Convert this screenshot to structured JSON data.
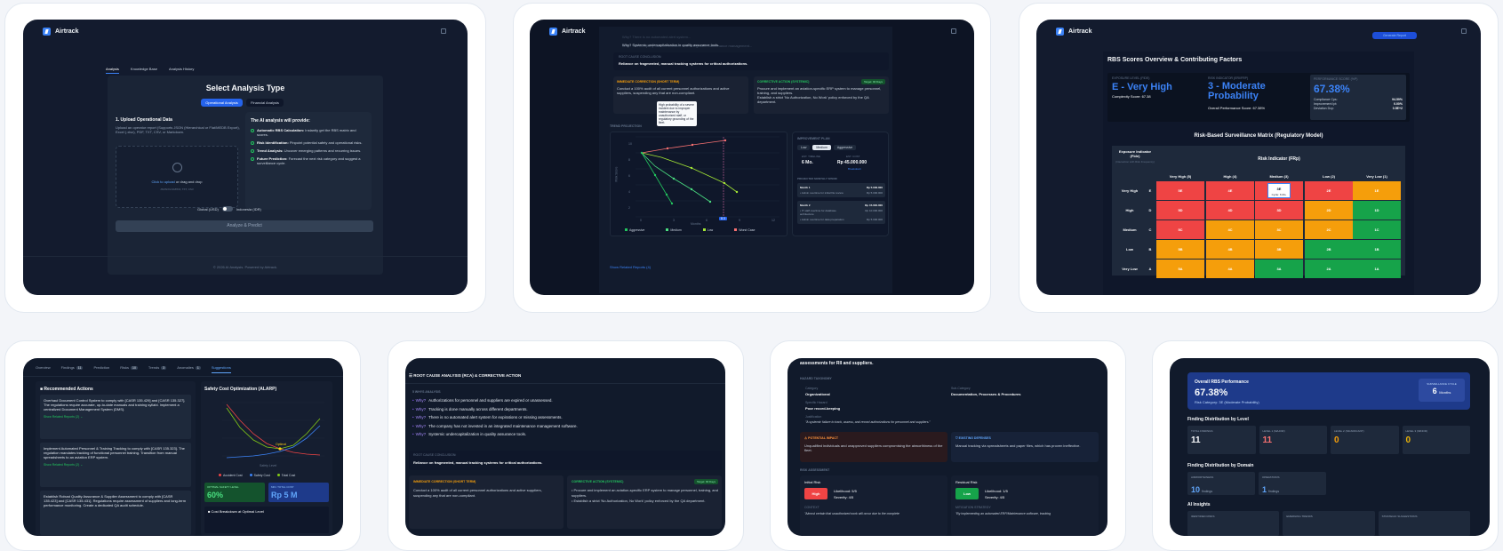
{
  "app": {
    "name": "Airtrack"
  },
  "s1": {
    "tabs": [
      "Analysis",
      "Knowledge Base",
      "Analysis History"
    ],
    "title": "Select Analysis Type",
    "type_buttons": [
      "Operational Analysis",
      "Financial Analysis"
    ],
    "upload_title": "1. Upload Operational Data",
    "upload_desc": "Upload an operator report (Supports JSON (Hierarchical or Flat/MEDB Export), Excel (.xlsx), PDF, TXT, CSV, or Markdown.",
    "upload_click": "Click to upload",
    "upload_or": " or drag and drop",
    "upload_formats": "JSON/XLSX/PDF, TXT, CSV",
    "ai_title": "The AI analysis will provide:",
    "ai_items": [
      {
        "b": "Automatic RBS Calculation:",
        "t": " Instantly get the RBS matrix and scores."
      },
      {
        "b": "Risk Identification:",
        "t": " Pinpoint potential safety and operational risks."
      },
      {
        "b": "Trend Analysis:",
        "t": " Uncover emerging patterns and recurring issues."
      },
      {
        "b": "Future Prediction:",
        "t": " Forecast the next risk category and suggest a surveillance cycle."
      }
    ],
    "toggle_left": "Global (USD)",
    "toggle_right": "Indonesia (IDR)",
    "analyze": "Analyze & Predict",
    "footer": "© 2026 AI Analysis. Powered by Airtrack."
  },
  "s2": {
    "why_faded": [
      "Why? There is no automated alert system...",
      "Why? The company has not invested in an integrated maintenance management..."
    ],
    "why5": "Why? Systemic undercapitalization in quality assurance tools.",
    "root_label": "ROOT CAUSE CONCLUSION:",
    "root": "Reliance on fragmented, manual tracking systems for critical authorizations.",
    "imm_label": "IMMEDIATE CORRECTION (SHORT TERM)",
    "imm": "Conduct a 100% audit of all current personnel authorizations and active suppliers, suspending any that are non-compliant.",
    "corr_label": "CORRECTIVE ACTION (SYSTEMIC)",
    "target": "Target: 90 Days",
    "corr": [
      "Procure and implement an aviation-specific ERP system to manage personnel, training, and suppliers.",
      "Establish a strict 'No Authorization, No Work' policy enforced by the QA department."
    ],
    "trend_label": "TREND PROJECTION",
    "tooltip": "High probability of a severe incident due to improper maintenance by unauthorized staff, or regulatory grounding of the fleet.",
    "ylabel": "Risk Score",
    "xlabel": "Months",
    "yticks": [
      "10",
      "8",
      "6",
      "4",
      "2"
    ],
    "xticks": [
      "0",
      "3",
      "6",
      "9",
      "12"
    ],
    "xbadge": "8.3",
    "legend": [
      "Aggressive",
      "Medium",
      "Low",
      "Worst Case"
    ],
    "plan_label": "IMPROVEMENT PLAN",
    "plan_tabs": [
      "Low",
      "Medium",
      "Aggressive"
    ],
    "est_time_label": "EST. TIMELINE",
    "est_time": "6 Mo.",
    "est_cost_label": "EST. COST",
    "est_cost": "Rp 45.000.000",
    "breakdown": "Breakdown",
    "spend_label": "PROJECTED MONTHLY SPEND",
    "months": [
      {
        "m": "Month 1",
        "amt": "Rp 5.000.000",
        "rows": [
          {
            "l": "• Admin overtime for initial file review",
            "v": "Rp 5.000.000"
          }
        ]
      },
      {
        "m": "Month 2",
        "amt": "Rp 15.000.000",
        "rows": [
          {
            "l": "• IT staff overtime for database architecture",
            "v": "Rp 10.000.000"
          },
          {
            "l": "• Admin overtime for data preparation",
            "v": "Rp 5.000.000"
          }
        ]
      }
    ],
    "show_related": "Show Related Reports (4)"
  },
  "s3": {
    "button": "Generate Report",
    "title": "RBS Scores Overview & Contributing Factors",
    "k1_label": "EXPOSURE LEVEL (FIDE)",
    "k1_value": "E - Very High",
    "k1_sub": "Complexity Score: 67.38",
    "k2_label": "RISK INDICATOR (ERI/FRP)",
    "k2_value": "3 - Moderate Probability",
    "k2_sub": "Overall Performance Score: 67.38%",
    "k3_label": "PERFORMANCE SCORE (%P)",
    "k3_value": "67.38%",
    "k3_rows": [
      {
        "l": "Compliance Cps:",
        "v": "94.59%"
      },
      {
        "l": "Improvement Ipt:",
        "v": "0.00%"
      },
      {
        "l": "Deviation Dcp:",
        "v": "0.5E+2"
      }
    ],
    "matrix_title": "Risk-Based Surveillance Matrix (Regulatory Model)",
    "exp_hdr": "Exposure Indicator (Fide)",
    "exp_sub": "(Interaction with Risk Frequency)",
    "risk_hdr": "Risk Indicator (FRp)",
    "cols": [
      "Very High (5)",
      "High (4)",
      "Medium (3)",
      "Low (2)",
      "Very Low (1)"
    ],
    "rows": [
      {
        "name": "Very High",
        "code": "E",
        "cells": [
          "5E",
          "4E",
          "3E",
          "2E",
          "1E"
        ]
      },
      {
        "name": "High",
        "code": "D",
        "cells": [
          "5D",
          "4D",
          "3D",
          "2D",
          "1D"
        ]
      },
      {
        "name": "Medium",
        "code": "C",
        "cells": [
          "5C",
          "4C",
          "3C",
          "2C",
          "1C"
        ]
      },
      {
        "name": "Low",
        "code": "B",
        "cells": [
          "5B",
          "4B",
          "3B",
          "2B",
          "1B"
        ]
      },
      {
        "name": "Very Low",
        "code": "A",
        "cells": [
          "5A",
          "4A",
          "3A",
          "2A",
          "1A"
        ]
      }
    ],
    "cell_colors": [
      [
        "red",
        "red",
        "red",
        "red",
        "org"
      ],
      [
        "red",
        "red",
        "red",
        "org",
        "grn"
      ],
      [
        "red",
        "org",
        "org",
        "org",
        "grn"
      ],
      [
        "org",
        "org",
        "org",
        "grn",
        "grn"
      ],
      [
        "org",
        "org",
        "grn",
        "grn",
        "grn"
      ]
    ],
    "highlight_cycle": "Cycle: 6 Mo."
  },
  "s4": {
    "tabs": [
      {
        "l": "Overview",
        "n": ""
      },
      {
        "l": "Findings",
        "n": "11"
      },
      {
        "l": "Prediction",
        "n": ""
      },
      {
        "l": "Risks",
        "n": "10"
      },
      {
        "l": "Trends",
        "n": "3"
      },
      {
        "l": "Anomalies",
        "n": "1"
      },
      {
        "l": "Suggestions",
        "n": ""
      }
    ],
    "rec_title": "Recommended Actions",
    "recs": [
      "Overhaul Document Control System to comply with [CASR 135.429] and [CASR 135.327]. The regulations require accurate, up-to-date manuals and training syllabi. Implement a centralized Document Management System (DMS).",
      "Implement Automated Personnel & Training Tracking to comply with [CASR 135.323]. The regulation mandates tracking of functional personnel training. Transition from manual spreadsheets to an aviation ERP system.",
      "Establish Robust Quality Assurance & Supplier Assessment to comply with [CASR 135.423] and [CASR 135.431]. Regulations require assessment of suppliers and long-term performance monitoring. Create a dedicated QA audit schedule."
    ],
    "show_related": "Show Related Reports (2)",
    "cost_title": "Safety Cost Optimization (ALARP)",
    "optimal": "Optimal",
    "xlabel": "Safety Level",
    "legend": [
      "Accident Cost",
      "Safety Cost",
      "Total Cost"
    ],
    "opt_label": "OPTIMAL SAFETY LEVEL",
    "opt_value": "60%",
    "min_label": "MIN. TOTAL COST",
    "min_value": "Rp 5 M",
    "breakdown": "Cost Breakdown at Optimal Level"
  },
  "s5": {
    "header": "ROOT CAUSE ANALYSIS (RCA) & CORRECTIVE ACTION",
    "whys_label": "5 WHYS ANALYSIS",
    "whys": [
      "Authorizations for personnel and suppliers are expired or unassessed.",
      "Tracking is done manually across different departments.",
      "There is no automated alert system for expirations or missing assessments.",
      "The company has not invested in an integrated maintenance management software.",
      "Systemic undercapitalization in quality assurance tools."
    ],
    "why_tag": "Why?",
    "root_label": "ROOT CAUSE CONCLUSION:",
    "root": "Reliance on fragmented, manual tracking systems for critical authorizations.",
    "imm_label": "IMMEDIATE CORRECTION (SHORT TERM)",
    "imm": "Conduct a 100% audit of all current personnel authorizations and active suppliers, suspending any that are non-compliant.",
    "corr_label": "CORRECTIVE ACTION (SYSTEMIC)",
    "target": "Target: 90 Days",
    "corr": [
      "Procure and implement an aviation-specific ERP system to manage personnel, training, and suppliers.",
      "Establish a strict 'No Authorization, No Work' policy enforced by the QA department."
    ]
  },
  "s6": {
    "top_text": "assessments for RII and suppliers.",
    "tax_label": "HAZARD TAXONOMY",
    "cat_label": "Category",
    "cat": "Organizational",
    "sub_label": "Sub-Category",
    "sub": "Documentation, Processes & Procedures",
    "spec_label": "Specific Hazard",
    "spec": "Poor record-keeping",
    "just_label": "Justification",
    "just": "\"A systemic failure to track, assess, and record authorizations for personnel and suppliers.\"",
    "impact_label": "POTENTIAL IMPACT",
    "impact": "Unqualified individuals and unapproved suppliers compromising the airworthiness of the fleet.",
    "def_label": "EXISTING DEFENSES",
    "def": "Manual tracking via spreadsheets and paper files, which has proven ineffective.",
    "assess_label": "RISK ASSESSMENT",
    "init_label": "Initial Risk",
    "init_badge": "High",
    "init_l": "Likelihood: 5/5",
    "init_s": "Severity: 4/5",
    "res_label": "Residual Risk",
    "res_badge": "Low",
    "res_l": "Likelihood: 1/5",
    "res_s": "Severity: 4/5",
    "ctx_label": "CONTEXT",
    "ctx": "\"Almost certain that unauthorized work will occur due to the complete",
    "mit_label": "MITIGATION STRATEGY",
    "mit": "\"By implementing an automated ERP/Maintenance software, tracking"
  },
  "s7": {
    "perf_label": "Overall RBS Performance",
    "perf": "67.38%",
    "perf_sub": "Risk Category: 3E (Moderate Probability)",
    "cyc_label": "SURVEILLANCE CYCLE",
    "cyc": "6",
    "cyc_unit": "Months",
    "lvl_title": "Finding Distribution by Level",
    "lvl": [
      {
        "l": "TOTAL FINDINGS",
        "v": "11",
        "c": "#f8fafc"
      },
      {
        "l": "LEVEL 1 (MAJOR)",
        "v": "11",
        "c": "#f87171"
      },
      {
        "l": "LEVEL 2 (SIGNIFICANT)",
        "v": "0",
        "c": "#f59e0b"
      },
      {
        "l": "LEVEL 3 (MINOR)",
        "v": "0",
        "c": "#eab308"
      }
    ],
    "dom_title": "Finding Distribution by Domain",
    "dom": [
      {
        "l": "AIRWORTHINESS",
        "v": "10",
        "u": "findings"
      },
      {
        "l": "OPERATIONS",
        "v": "1",
        "u": "findings"
      }
    ],
    "ai_title": "AI Insights",
    "ai_cols": [
      "IDENTIFIED RISKS",
      "EMERGING TRENDS",
      "STRATEGIC SUGGESTIONS"
    ]
  }
}
